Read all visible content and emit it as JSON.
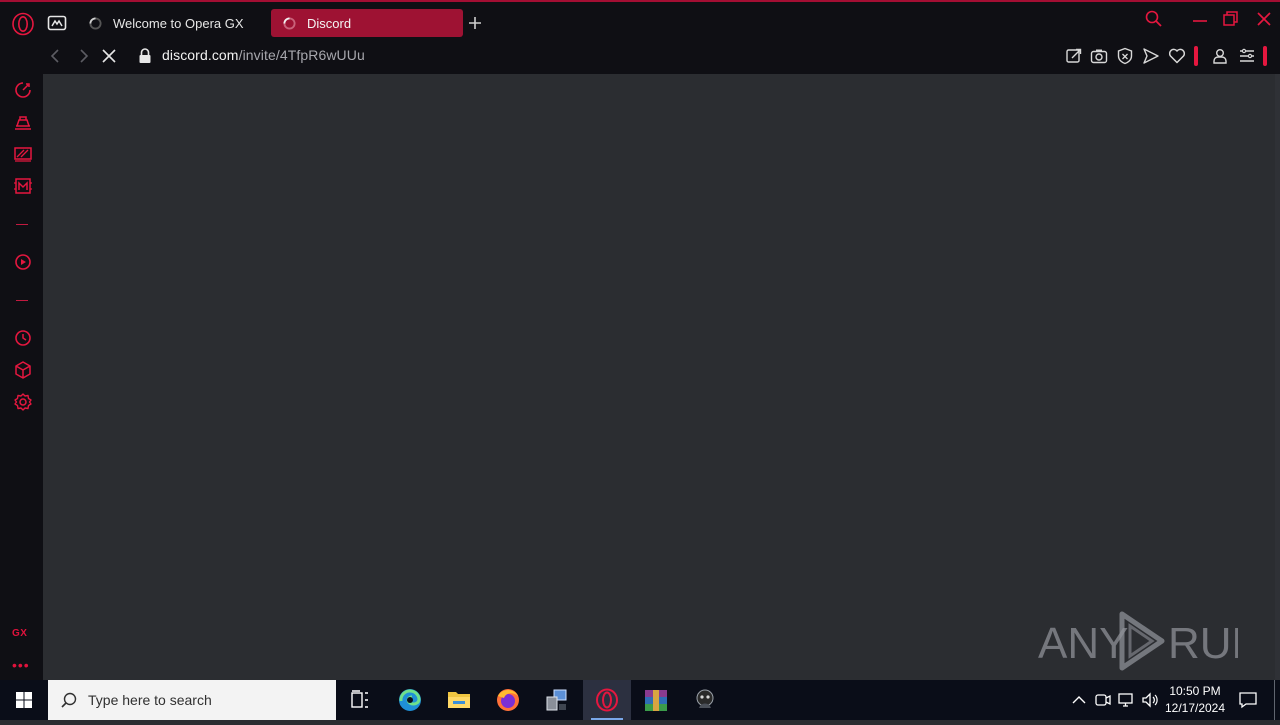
{
  "browser": {
    "tabs": [
      {
        "label": "Welcome to Opera GX",
        "active": false,
        "loading": true
      },
      {
        "label": "Discord",
        "active": true,
        "loading": true
      }
    ],
    "address": {
      "host": "discord.com",
      "path": "/invite/4TfpR6wUUu"
    }
  },
  "sidebar": {
    "icons": [
      "speed-dial-icon",
      "gx-control-icon",
      "twitch-icon",
      "gx-corner-icon",
      "player-icon",
      "history-icon",
      "extensions-icon",
      "settings-icon"
    ],
    "gx_label": "GX",
    "more_label": "•••"
  },
  "taskbar": {
    "search_placeholder": "Type here to search",
    "apps": [
      "task-view",
      "edge",
      "file-explorer",
      "firefox",
      "network-app",
      "opera-gx",
      "winrar",
      "hacker-app"
    ],
    "clock_time": "10:50 PM",
    "clock_date": "12/17/2024"
  },
  "watermark": {
    "text_left": "ANY",
    "text_right": "RUN"
  },
  "colors": {
    "accent": "#e5173f",
    "active_tab": "#9e1233",
    "content_bg": "#2b2d31",
    "chrome_bg": "#0f0f14"
  }
}
